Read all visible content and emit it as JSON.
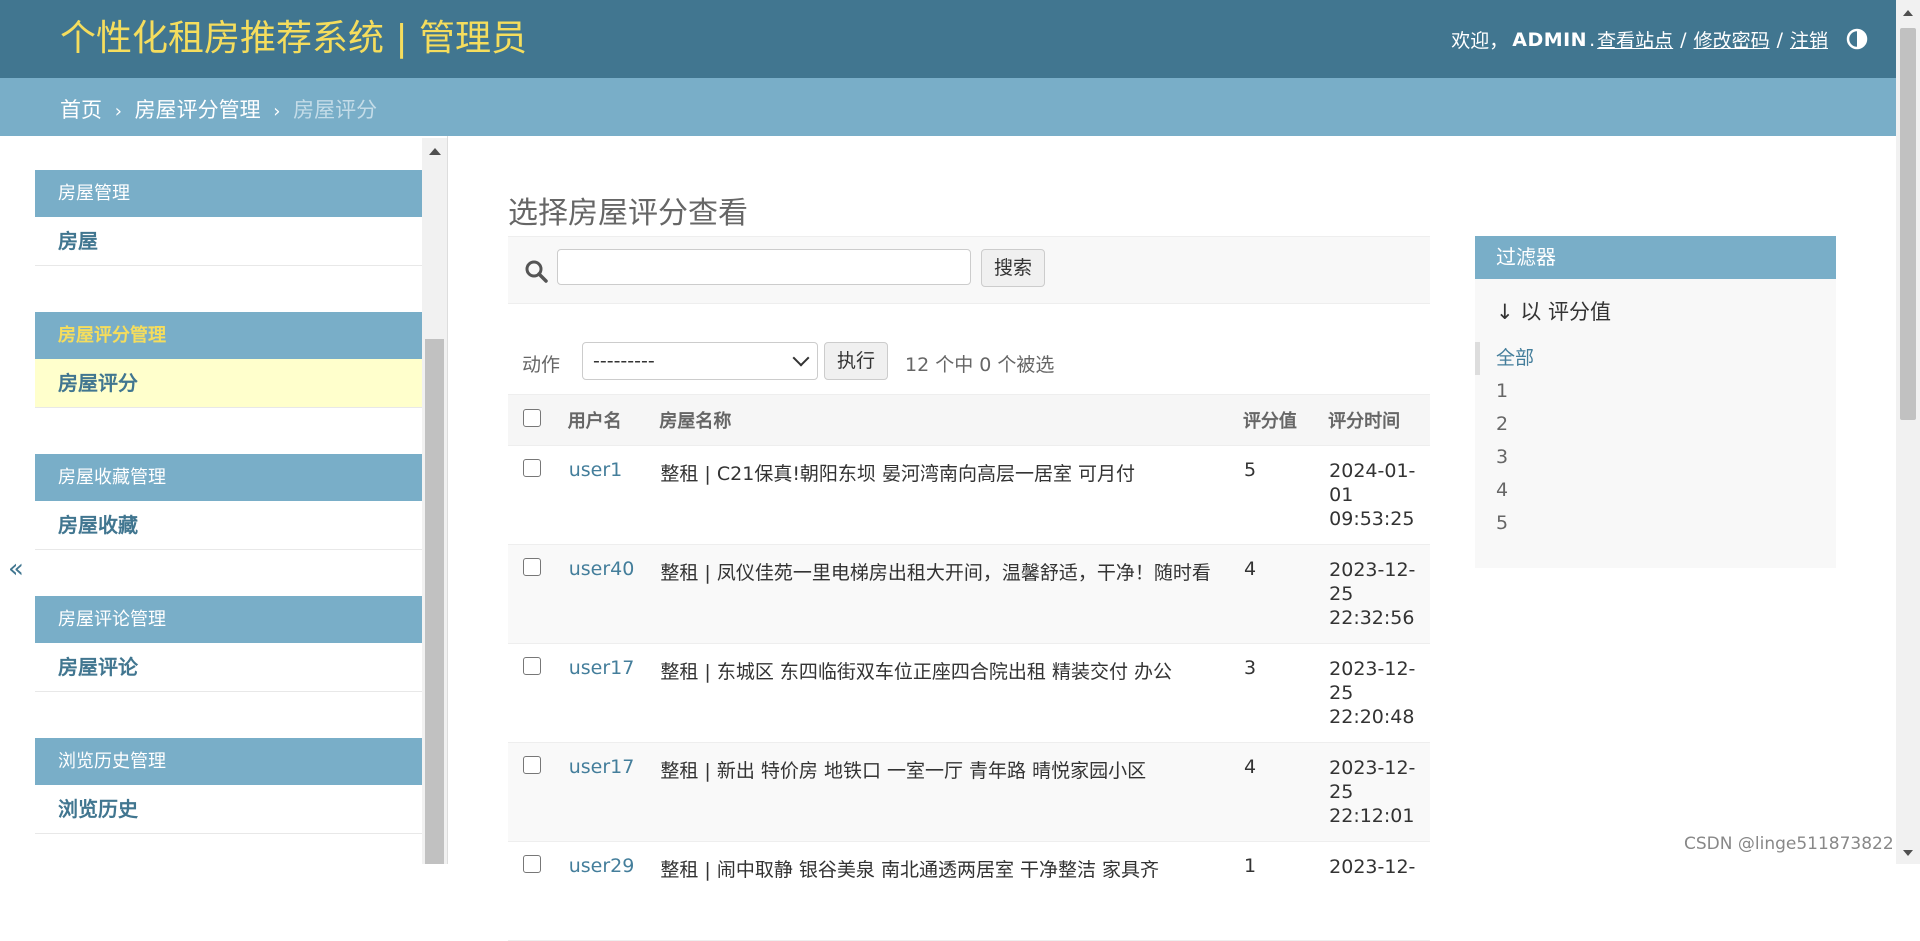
{
  "header": {
    "brand": "个性化租房推荐系统 | 管理员",
    "welcome": "欢迎，",
    "username": "ADMIN",
    "period": ".",
    "view_site": "查看站点",
    "change_password": "修改密码",
    "logout": "注销",
    "separator": "/"
  },
  "breadcrumbs": {
    "home": "首页",
    "app": "房屋评分管理",
    "current": "房屋评分",
    "arrow": "›"
  },
  "sidebar": {
    "modules": [
      {
        "caption": "房屋管理",
        "item": "房屋"
      },
      {
        "caption": "房屋评分管理",
        "item": "房屋评分"
      },
      {
        "caption": "房屋收藏管理",
        "item": "房屋收藏"
      },
      {
        "caption": "房屋评论管理",
        "item": "房屋评论"
      },
      {
        "caption": "浏览历史管理",
        "item": "浏览历史"
      }
    ],
    "collapse": "«"
  },
  "main": {
    "title": "选择房屋评分查看",
    "search": {
      "button": "搜索",
      "value": ""
    },
    "actions": {
      "label": "动作",
      "selected": "---------",
      "go": "执行",
      "counter": "12 个中 0 个被选"
    },
    "table": {
      "headers": [
        "用户名",
        "房屋名称",
        "评分值",
        "评分时间"
      ],
      "rows": [
        {
          "user": "user1",
          "house": "整租 | C21保真!朝阳东坝 晏河湾南向高层一居室 可月付",
          "score": "5",
          "time": "2024-01-01 09:53:25",
          "time_lines": [
            "2024-01-",
            "01",
            "09:53:25"
          ]
        },
        {
          "user": "user40",
          "house": "整租 | 凤仪佳苑一里电梯房出租大开间，温馨舒适，干净！随时看",
          "score": "4",
          "time": "2023-12-25 22:32:56",
          "time_lines": [
            "2023-12-",
            "25",
            "22:32:56"
          ]
        },
        {
          "user": "user17",
          "house": "整租 | 东城区 东四临街双车位正座四合院出租 精装交付 办公",
          "score": "3",
          "time": "2023-12-25 22:20:48",
          "time_lines": [
            "2023-12-",
            "25",
            "22:20:48"
          ]
        },
        {
          "user": "user17",
          "house": "整租 | 新出 特价房 地铁口 一室一厅 青年路 晴悦家园小区",
          "score": "4",
          "time": "2023-12-25 22:12:01",
          "time_lines": [
            "2023-12-",
            "25",
            "22:12:01"
          ]
        },
        {
          "user": "user29",
          "house": "整租 | 闹中取静 银谷美泉 南北通透两居室 干净整洁 家具齐",
          "score": "1",
          "time": "2023-12-",
          "time_lines": [
            "2023-12-",
            "",
            ""
          ]
        }
      ]
    }
  },
  "filter": {
    "caption": "过滤器",
    "heading": "↓ 以 评分值",
    "options": [
      "全部",
      "1",
      "2",
      "3",
      "4",
      "5"
    ]
  },
  "watermark": "CSDN @linge511873822",
  "colors": {
    "header_bg": "#417690",
    "brand": "#f5dd5d",
    "crumbs_bg": "#79aec8",
    "link": "#447e9b",
    "active_row": "#ffffcc"
  }
}
